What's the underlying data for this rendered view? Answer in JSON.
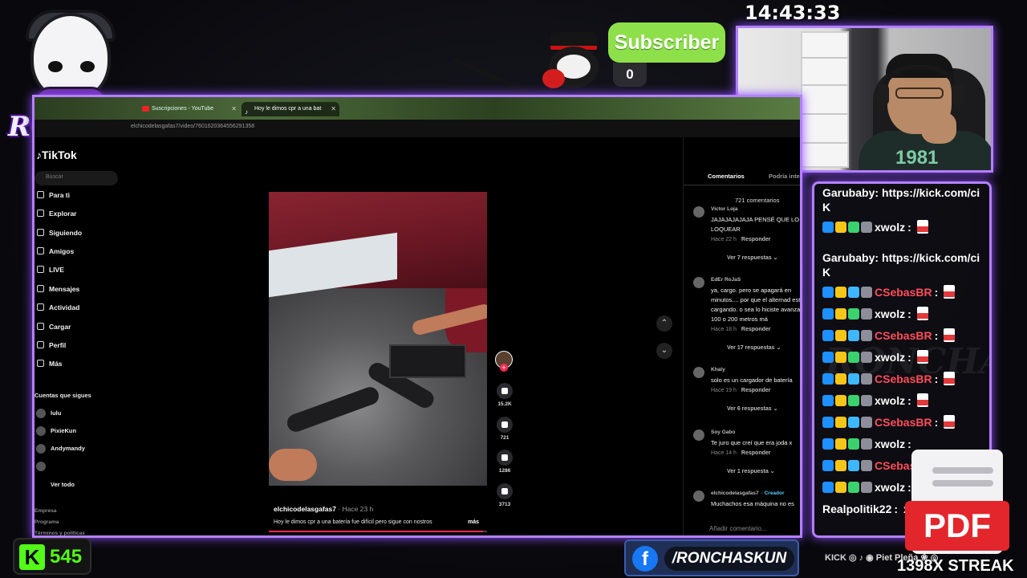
{
  "overlay": {
    "logo_text": "RONCHAS",
    "clock": "14:43:33",
    "subscriber": {
      "label": "Subscriber",
      "count": "0"
    },
    "kick_count": "545",
    "facebook_handle": "/RONCHASKUN",
    "socials_text": "KICK ◎ ♪ ◉ Piet Pleña ❀ ◎",
    "streak_text": "1398X STREAK",
    "big_pdf_label": "PDF",
    "cam_shirt_text": "1981",
    "chat_watermark": "RONCHAS"
  },
  "chat": {
    "messages": [
      {
        "user": "Garubaby",
        "user_color": "#ffffff",
        "text": "https://kick.com/ci K",
        "badges": [],
        "pdf": false,
        "wrap": true
      },
      {
        "user": "xwolz",
        "user_color": "#ffffff",
        "text": "",
        "badges": [
          "#1e90ff",
          "#f5c518",
          "#3bd16f",
          "#8e8e9a"
        ],
        "pdf": true,
        "wrap": false
      },
      {
        "user": "Garubaby",
        "user_color": "#ffffff",
        "text": "https://kick.com/ci K",
        "badges": [],
        "pdf": false,
        "wrap": true
      },
      {
        "user": "CSebasBR",
        "user_color": "#ff4d5a",
        "text": "",
        "badges": [
          "#1e90ff",
          "#f5c518",
          "#3fb7ff",
          "#8e8e9a"
        ],
        "pdf": true,
        "wrap": false
      },
      {
        "user": "xwolz",
        "user_color": "#ffffff",
        "text": "",
        "badges": [
          "#1e90ff",
          "#f5c518",
          "#3bd16f",
          "#8e8e9a"
        ],
        "pdf": true,
        "wrap": false
      },
      {
        "user": "CSebasBR",
        "user_color": "#ff4d5a",
        "text": "",
        "badges": [
          "#1e90ff",
          "#f5c518",
          "#3fb7ff",
          "#8e8e9a"
        ],
        "pdf": true,
        "wrap": false
      },
      {
        "user": "xwolz",
        "user_color": "#ffffff",
        "text": "",
        "badges": [
          "#1e90ff",
          "#f5c518",
          "#3bd16f",
          "#8e8e9a"
        ],
        "pdf": true,
        "wrap": false
      },
      {
        "user": "CSebasBR",
        "user_color": "#ff4d5a",
        "text": "",
        "badges": [
          "#1e90ff",
          "#f5c518",
          "#3fb7ff",
          "#8e8e9a"
        ],
        "pdf": true,
        "wrap": false
      },
      {
        "user": "xwolz",
        "user_color": "#ffffff",
        "text": "",
        "badges": [
          "#1e90ff",
          "#f5c518",
          "#3bd16f",
          "#8e8e9a"
        ],
        "pdf": true,
        "wrap": false
      },
      {
        "user": "CSebasBR",
        "user_color": "#ff4d5a",
        "text": "",
        "badges": [
          "#1e90ff",
          "#f5c518",
          "#3fb7ff",
          "#8e8e9a"
        ],
        "pdf": true,
        "wrap": false
      },
      {
        "user": "xwolz",
        "user_color": "#ffffff",
        "text": "",
        "badges": [
          "#1e90ff",
          "#f5c518",
          "#3bd16f",
          "#8e8e9a"
        ],
        "pdf": false,
        "wrap": false
      },
      {
        "user": "CSebas",
        "user_color": "#ff4d5a",
        "text": "",
        "badges": [
          "#1e90ff",
          "#f5c518",
          "#3fb7ff",
          "#8e8e9a"
        ],
        "pdf": false,
        "wrap": false
      },
      {
        "user": "xwolz",
        "user_color": "#ffffff",
        "text": "",
        "badges": [
          "#1e90ff",
          "#f5c518",
          "#3bd16f",
          "#8e8e9a"
        ],
        "pdf": false,
        "wrap": false
      },
      {
        "user": "Realpolitik22",
        "user_color": "#ffffff",
        "text": "x",
        "badges": [],
        "pdf": false,
        "wrap": false
      }
    ]
  },
  "browser": {
    "tabs": [
      {
        "label": "Suscripciones - YouTube",
        "active": false
      },
      {
        "label": "Hoy le dimos cpr a una bat",
        "active": true
      }
    ],
    "url": "elchicodelasgafas7/video/7601620364556291358"
  },
  "tiktok": {
    "logo": "TikTok",
    "search_placeholder": "Buscar",
    "nav": [
      "Para ti",
      "Explorar",
      "Siguiendo",
      "Amigos",
      "LIVE",
      "Mensajes",
      "Actividad",
      "Cargar",
      "Perfil",
      "Más"
    ],
    "following_heading": "Cuentas que sigues",
    "following": [
      "lulu",
      "PixieKun",
      "Andymandy",
      "",
      "Ver todo"
    ],
    "footer": [
      "Empresa",
      "Programa",
      "Términos y políticas"
    ],
    "video": {
      "username": "elchicodelasgafas7",
      "time": "· Hace 23 h",
      "caption": "Hoy le dimos cpr a una batería fue difícil   pero sigue con nostros",
      "more": "más",
      "progress": 0.98
    },
    "actions": [
      {
        "icon": "heart-icon",
        "count": "15.2K"
      },
      {
        "icon": "comment-icon",
        "count": "721"
      },
      {
        "icon": "bookmark-icon",
        "count": "1286"
      },
      {
        "icon": "share-icon",
        "count": "3713"
      }
    ],
    "comments_tabs": [
      "Comentarios",
      "Podría inte"
    ],
    "comments_count": "721 comentarios",
    "comments": [
      {
        "user": "Victor Loja",
        "text": "JAJAJAJAJAJA PENSÉ QUE LO LOQUEAR",
        "meta": "Hace 22 h",
        "reply": "Responder",
        "replies": "Ver 7 respuestas ⌄",
        "creator": ""
      },
      {
        "user": "EdEr RoJaS",
        "text": "ya, cargo. pero se apagará en minutos.... por que el alternad está cargando. o sea lo hiciste avanzar 100 o 200 metros má",
        "meta": "Hace 18 h",
        "reply": "Responder",
        "replies": "Ver 17 respuestas ⌄",
        "creator": ""
      },
      {
        "user": "Khaly",
        "text": "solo es un cargador de batería",
        "meta": "Hace 19 h",
        "reply": "Responder",
        "replies": "Ver 6 respuestas ⌄",
        "creator": ""
      },
      {
        "user": "Soy Gabo",
        "text": "Te juro que creí que era joda x",
        "meta": "Hace 14 h",
        "reply": "Responder",
        "replies": "Ver 1 respuesta ⌄",
        "creator": ""
      },
      {
        "user": "elchicodelasgafas7",
        "text": "Muchachos esa máquina no es",
        "meta": "",
        "reply": "",
        "replies": "",
        "creator": "· Creador"
      }
    ],
    "comment_placeholder": "Añadir comentario..."
  }
}
